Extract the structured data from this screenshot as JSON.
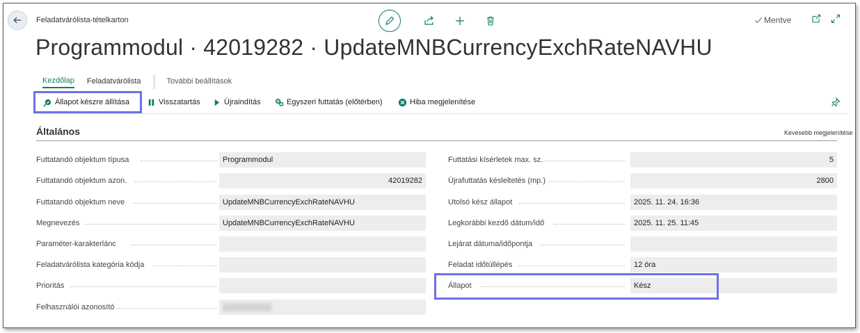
{
  "breadcrumb": "Feladatvárólista-tételkarton",
  "page_title": "Programmodul · 42019282 · UpdateMNBCurrencyExchRateNAVHU",
  "status": {
    "saved_label": "Mentve"
  },
  "nav_tabs": [
    {
      "label": "Kezdőlap"
    },
    {
      "label": "Feladatvárólista"
    },
    {
      "label": "További beállítások"
    }
  ],
  "actions": [
    {
      "label": "Állapot készre állítása",
      "icon": "set-ready-icon"
    },
    {
      "label": "Visszatartás",
      "icon": "pause-icon"
    },
    {
      "label": "Újraindítás",
      "icon": "play-icon"
    },
    {
      "label": "Egyszeri futtatás (előtérben)",
      "icon": "run-once-icon"
    },
    {
      "label": "Hiba megjelenítése",
      "icon": "error-icon"
    }
  ],
  "section": {
    "title": "Általános",
    "toggle_label": "Kevesebb megjelenítése"
  },
  "left_fields": [
    {
      "label": "Futtatandó objektum típusa",
      "value": "Programmodul"
    },
    {
      "label": "Futtatandó objektum azon.",
      "value": "42019282"
    },
    {
      "label": "Futtatandó objektum neve",
      "value": "UpdateMNBCurrencyExchRateNAVHU"
    },
    {
      "label": "Megnevezés",
      "value": "UpdateMNBCurrencyExchRateNAVHU"
    },
    {
      "label": "Paraméter-karakterlánc",
      "value": ""
    },
    {
      "label": "Feladatvárólista kategória kódja",
      "value": ""
    },
    {
      "label": "Prioritás",
      "value": ""
    },
    {
      "label": "Felhasználói azonosító",
      "value": ""
    }
  ],
  "right_fields": [
    {
      "label": "Futtatási kísérletek max. sz.",
      "value": "5"
    },
    {
      "label": "Újrafuttatás késleltetés (mp.)",
      "value": "2800"
    },
    {
      "label": "Utolsó kész állapot",
      "value": "2025. 11. 24. 16:36"
    },
    {
      "label": "Legkorábbi kezdő dátum/idő",
      "value": "2025. 11. 25. 11:45"
    },
    {
      "label": "Lejárat dátuma/időpontja",
      "value": ""
    },
    {
      "label": "Feladat időtúllépés",
      "value": "12 óra"
    },
    {
      "label": "Állapot",
      "value": "Kész"
    }
  ],
  "colors": {
    "accent": "#107c6a",
    "highlight": "#6d70e8"
  }
}
